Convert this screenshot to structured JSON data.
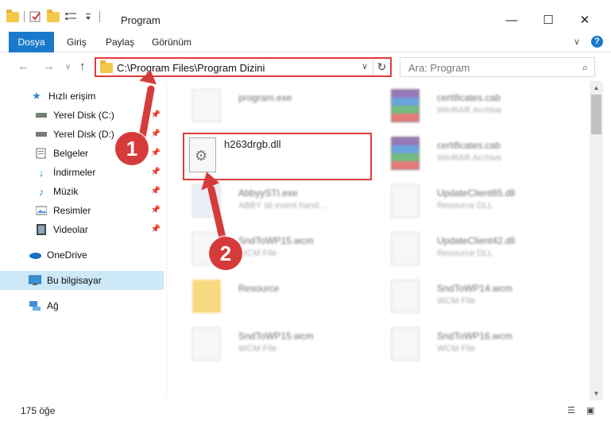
{
  "window": {
    "title": "Program",
    "minimize": "—",
    "maximize": "☐",
    "close": "✕"
  },
  "ribbon": {
    "tabs": [
      "Dosya",
      "Giriş",
      "Paylaş",
      "Görünüm"
    ],
    "expand": "∨",
    "help": "?"
  },
  "address": {
    "path": "C:\\Program Files\\Program Dizini",
    "chevron": "∨",
    "refresh": "↻"
  },
  "search": {
    "placeholder": "Ara: Program",
    "icon": "⌕"
  },
  "nav": {
    "back": "←",
    "forward": "→",
    "history": "∨",
    "up": "↑"
  },
  "sidebar": {
    "items": [
      {
        "label": "Hızlı erişim",
        "icon": "star-icon"
      },
      {
        "label": "Yerel Disk (C:)",
        "icon": "drive-icon"
      },
      {
        "label": "Yerel Disk (D:)",
        "icon": "drive-icon"
      },
      {
        "label": "Belgeler",
        "icon": "documents-icon"
      },
      {
        "label": "İndirmeler",
        "icon": "download-icon"
      },
      {
        "label": "Müzik",
        "icon": "music-icon"
      },
      {
        "label": "Resimler",
        "icon": "pictures-icon"
      },
      {
        "label": "Videolar",
        "icon": "videos-icon"
      },
      {
        "label": "OneDrive",
        "icon": "cloud-icon"
      },
      {
        "label": "Bu bilgisayar",
        "icon": "computer-icon"
      },
      {
        "label": "Ağ",
        "icon": "network-icon"
      }
    ]
  },
  "files": [
    {
      "name": "program.exe",
      "type": ""
    },
    {
      "name": "certificates.cab",
      "type": "WinRAR Archive"
    },
    {
      "name": "h263drgb.dll",
      "type": ""
    },
    {
      "name": "certificates.cab",
      "type": "WinRAR Archive"
    },
    {
      "name": "AbbyySTI.exe",
      "type": "ABBY sti event hand..."
    },
    {
      "name": "UpdateClient65.dll",
      "type": "Resource DLL"
    },
    {
      "name": "SndToWP15.wcm",
      "type": "WCM File"
    },
    {
      "name": "UpdateClient42.dll",
      "type": "Resource DLL"
    },
    {
      "name": "Resource",
      "type": ""
    },
    {
      "name": "SndToWP14.wcm",
      "type": "WCM File"
    },
    {
      "name": "SndToWP15.wcm",
      "type": "WCM File"
    },
    {
      "name": "SndToWP16.wcm",
      "type": "WCM File"
    }
  ],
  "status": {
    "count": "175 öğe"
  },
  "callouts": {
    "one": "1",
    "two": "2"
  },
  "colors": {
    "accent": "#1979ca",
    "callout": "#d63b3b",
    "selection": "#cde8f7"
  }
}
